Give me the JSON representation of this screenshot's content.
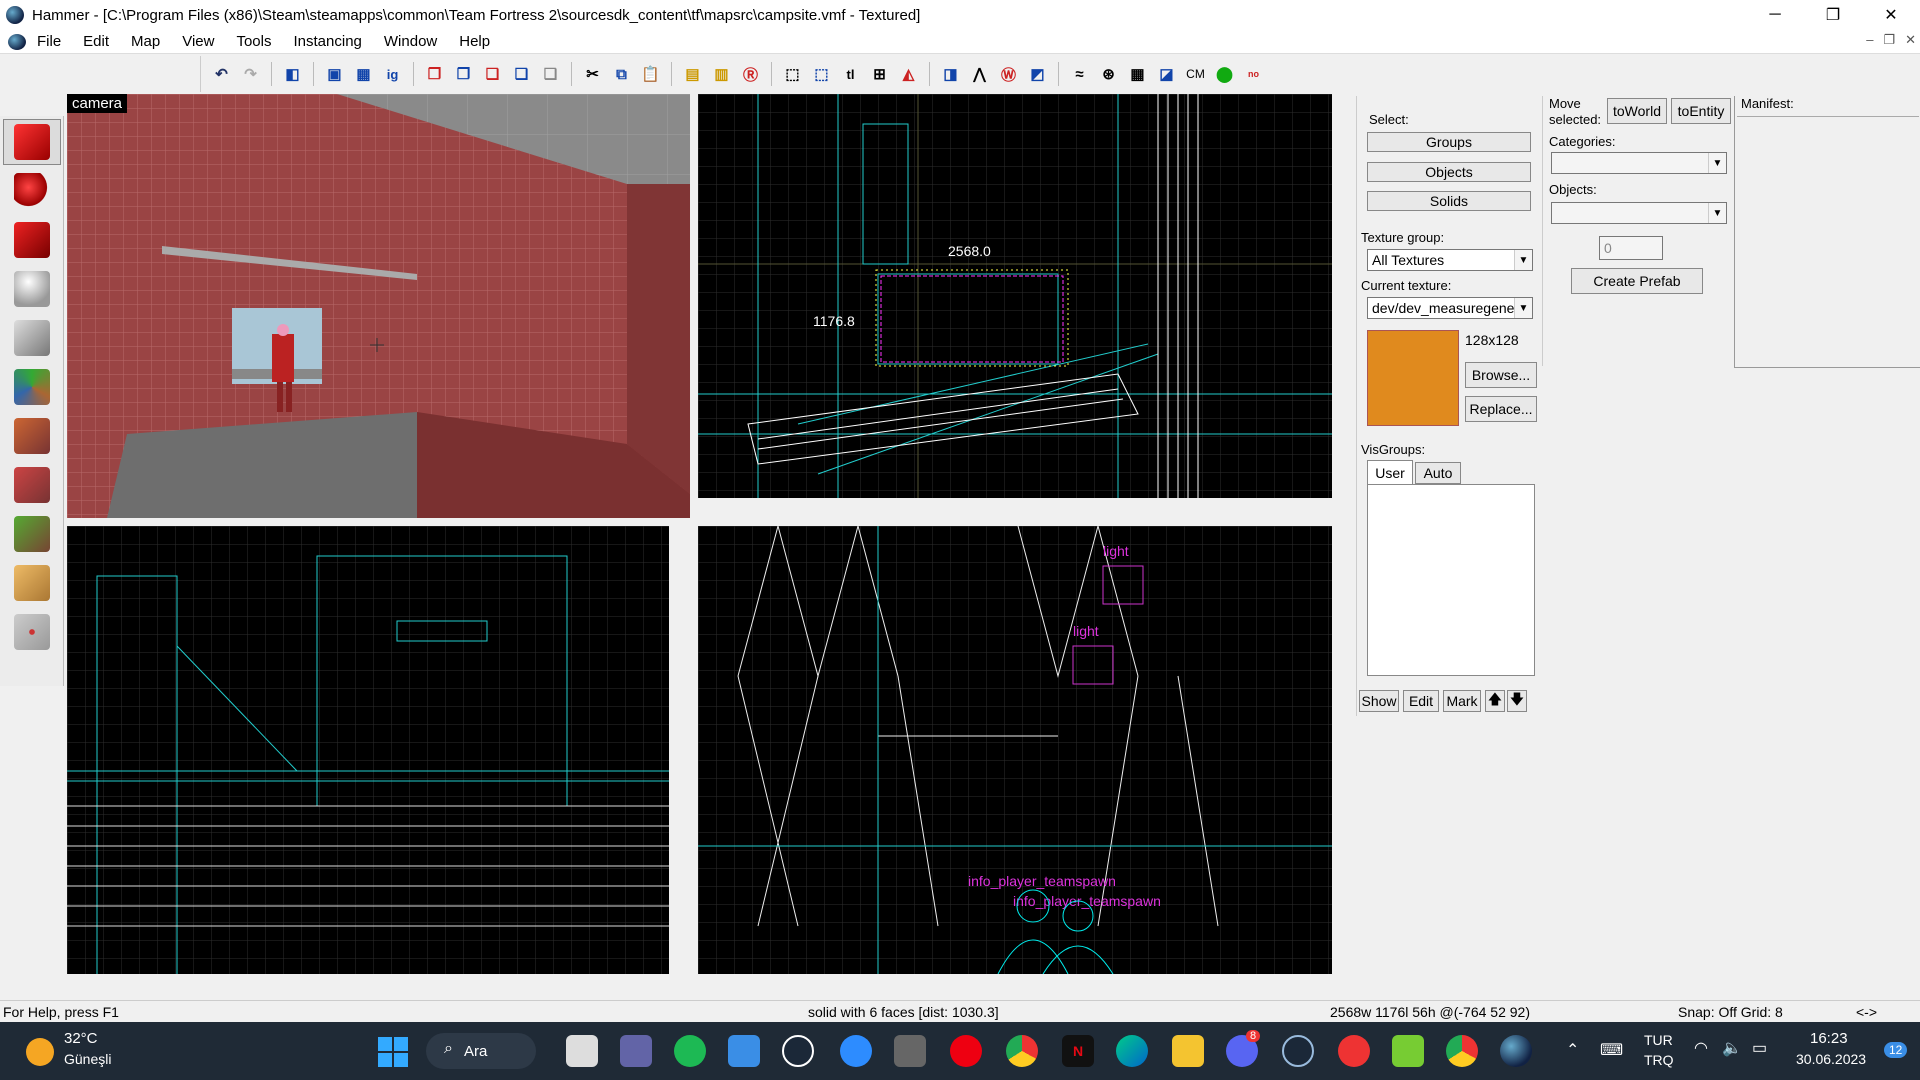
{
  "window": {
    "title": "Hammer - [C:\\Program Files (x86)\\Steam\\steamapps\\common\\Team Fortress 2\\sourcesdk_content\\tf\\mapsrc\\campsite.vmf - Textured]",
    "minimize": "─",
    "maximize": "❐",
    "close": "✕"
  },
  "menu": [
    "File",
    "Edit",
    "Map",
    "View",
    "Tools",
    "Instancing",
    "Window",
    "Help"
  ],
  "mdi_controls": [
    "–",
    "❐",
    "✕"
  ],
  "toolbar": {
    "cm_label": "CM"
  },
  "viewports": {
    "camera_label": "camera",
    "top_dim_width": "2568.0",
    "top_dim_height": "1176.8",
    "side_labels": [
      "light",
      "light",
      "info_player_teamspawn",
      "info_player_teamspawn"
    ]
  },
  "select": {
    "label": "Select:",
    "groups": "Groups",
    "objects": "Objects",
    "solids": "Solids"
  },
  "texture": {
    "group_label": "Texture group:",
    "group_value": "All Textures",
    "current_label": "Current texture:",
    "current_value": "dev/dev_measuregene",
    "size": "128x128",
    "browse": "Browse...",
    "replace": "Replace...",
    "swatch_color": "#e08a1e"
  },
  "visgroups": {
    "label": "VisGroups:",
    "tab_user": "User",
    "tab_auto": "Auto",
    "show": "Show",
    "edit": "Edit",
    "mark": "Mark",
    "up": "🡅",
    "down": "🡇"
  },
  "move": {
    "label": "Move selected:",
    "to_world": "toWorld",
    "to_entity": "toEntity"
  },
  "prefab": {
    "categories_label": "Categories:",
    "objects_label": "Objects:",
    "spin_value": "0",
    "create": "Create Prefab"
  },
  "manifest": {
    "label": "Manifest:"
  },
  "status": {
    "help": "For Help, press F1",
    "selection": "solid with 6 faces  [dist: 1030.3]",
    "dimensions": "2568w 1176l 56h @(-764 52 92)",
    "snap": "Snap: Off Grid: 8",
    "arrows": "<->"
  },
  "taskbar": {
    "weather_temp": "32°C",
    "weather_desc": "Güneşli",
    "search": "Ara",
    "lang_top": "TUR",
    "lang_bottom": "TRQ",
    "time": "16:23",
    "date": "30.06.2023",
    "notif": "12",
    "discord_badge": "8"
  }
}
